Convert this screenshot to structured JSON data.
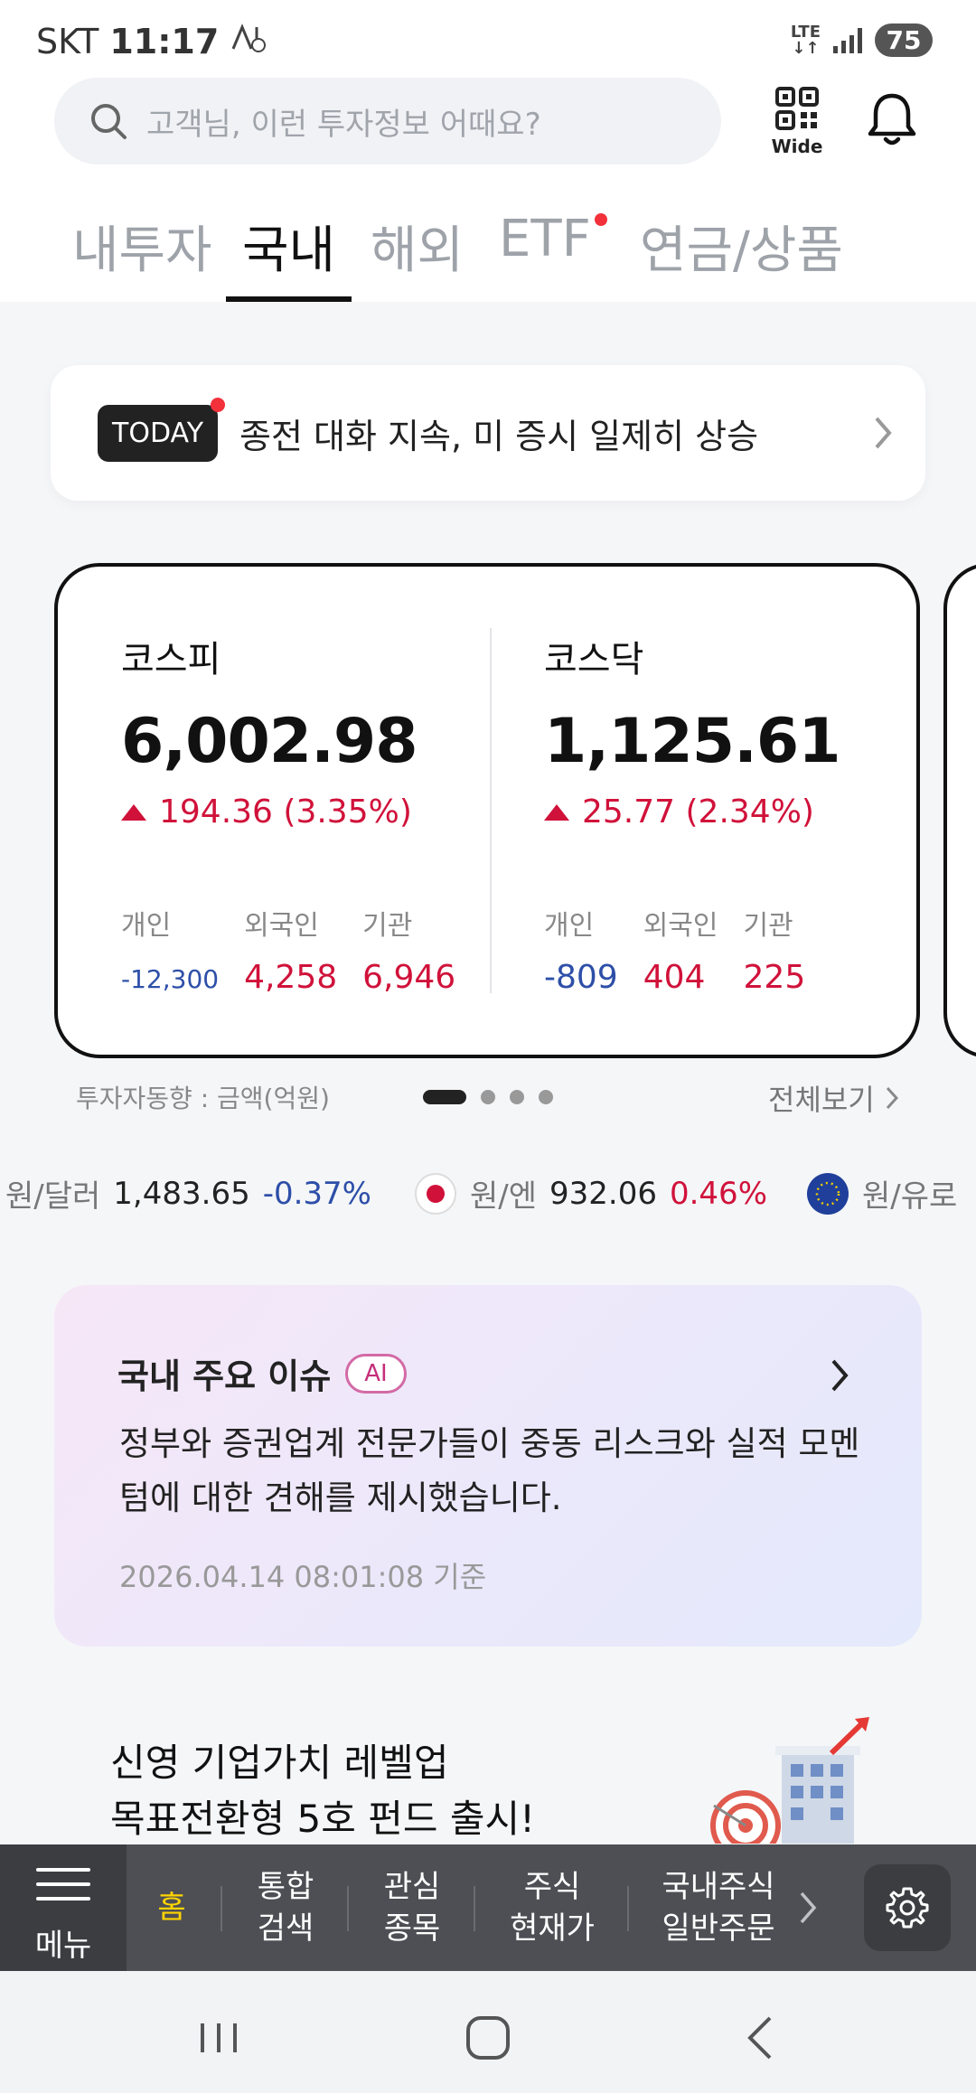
{
  "status_bar": {
    "carrier": "SKT",
    "time": "11:17",
    "network": "LTE",
    "battery": "75"
  },
  "header": {
    "search_placeholder": "고객님, 이런 투자정보 어때요?",
    "qr_label": "Wide"
  },
  "tabs": [
    {
      "label": "내투자",
      "active": false
    },
    {
      "label": "국내",
      "active": true
    },
    {
      "label": "해외",
      "active": false
    },
    {
      "label": "ETF",
      "active": false,
      "dot": true
    },
    {
      "label": "연금/상품",
      "active": false
    }
  ],
  "today": {
    "badge": "TODAY",
    "headline": "종전 대화 지속, 미 증시 일제히 상승"
  },
  "market": {
    "flow_labels": [
      "개인",
      "외국인",
      "기관"
    ],
    "indices": [
      {
        "name": "코스피",
        "value": "6,002.98",
        "change": "194.36 (3.35%)",
        "flows": [
          "-12,300",
          "4,258",
          "6,946"
        ]
      },
      {
        "name": "코스닥",
        "value": "1,125.61",
        "change": "25.77 (2.34%)",
        "flows": [
          "-809",
          "404",
          "225"
        ]
      }
    ],
    "note": "투자자동향 : 금액(억원)",
    "view_all": "전체보기",
    "page_count": 4,
    "current_page": 1
  },
  "fx": [
    {
      "label": "원/달러",
      "value": "1,483.65",
      "change": "-0.37%"
    },
    {
      "label": "원/엔",
      "value": "932.06",
      "change": "0.46%"
    },
    {
      "label": "원/유로",
      "value": "",
      "change": ""
    }
  ],
  "issue": {
    "title": "국내 주요 이슈",
    "ai_tag": "AI",
    "body": "정부와 증권업계 전문가들이 중동 리스크와 실적 모멘텀에 대한 견해를 제시했습니다.",
    "timestamp": "2026.04.14 08:01:08 기준"
  },
  "promo": {
    "line1": "신영 기업가치 레벨업",
    "line2": "목표전환형 5호 펀드 출시!"
  },
  "bottom_menu": {
    "menu_label": "메뉴",
    "items": [
      {
        "line1": "홈",
        "line2": ""
      },
      {
        "line1": "통합",
        "line2": "검색"
      },
      {
        "line1": "관심",
        "line2": "종목"
      },
      {
        "line1": "주식",
        "line2": "현재가"
      },
      {
        "line1": "국내주식",
        "line2": "일반주문"
      }
    ]
  },
  "colors": {
    "up": "#d0123a",
    "down": "#2d4fa8",
    "home_highlight": "#ffd400",
    "notification_dot": "#f2313b"
  }
}
